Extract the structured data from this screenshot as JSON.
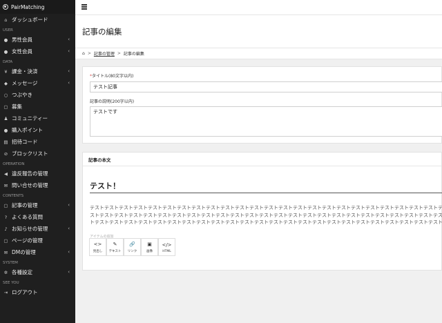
{
  "app": {
    "brand": "PairMatching"
  },
  "sidebar": {
    "sections": {
      "user": "USER",
      "data": "DATA",
      "operation": "OPERATION",
      "contents": "CONTENTS",
      "system": "SYSTEM",
      "seeyou": "SEE YOU"
    },
    "items": {
      "dashboard": "ダッシュボード",
      "male": "男性会員",
      "female": "女性会員",
      "billing": "課金・決済",
      "message": "メッセージ",
      "tsubuyaki": "つぶやき",
      "recruit": "募集",
      "community": "コミュニティー",
      "points": "購入ポイント",
      "invite": "招待コード",
      "block": "ブロックリスト",
      "violation": "違反報告の管理",
      "inquiry": "問い合せの管理",
      "articles": "記事の管理",
      "faq": "よくある質問",
      "news": "お知らせの管理",
      "pages": "ページの管理",
      "dm": "DMの管理",
      "settings": "各種設定",
      "logout": "ログアウト"
    }
  },
  "page": {
    "title": "記事の編集",
    "breadcrumb": {
      "home": "⌂",
      "sep": ">",
      "parent": "記事の管理",
      "current": "記事の編集"
    }
  },
  "form": {
    "title_required": "*",
    "title_label": "タイトル(80文字以内)",
    "title_value": "テスト記事",
    "desc_label": "記事の説明(200字以内)",
    "desc_value": "テストです"
  },
  "article": {
    "header": "記事の本文",
    "heading": "テスト！",
    "body": "テストテストテストテストテストテストテストテストテストテストテストテストテストテストテストテストテストテストテストテストテストテストテストテストテストテストテストテストテストテストテストテストテストテストテストテストテストテストテストテストテストテストテストテストテストテストテストテストテストテストテストテストテストテストテストテストテストテストテストテストテストテストテストテストテストテストテストテストテストテストテストテストテスト",
    "tool_caption": "アイテムの追加",
    "tools": [
      {
        "label": "見出し",
        "icon": "<>"
      },
      {
        "label": "テキスト",
        "icon": "✎"
      },
      {
        "label": "リンク",
        "icon": "🔗"
      },
      {
        "label": "画像",
        "icon": "▣"
      },
      {
        "label": "HTML",
        "icon": "</>"
      }
    ]
  }
}
